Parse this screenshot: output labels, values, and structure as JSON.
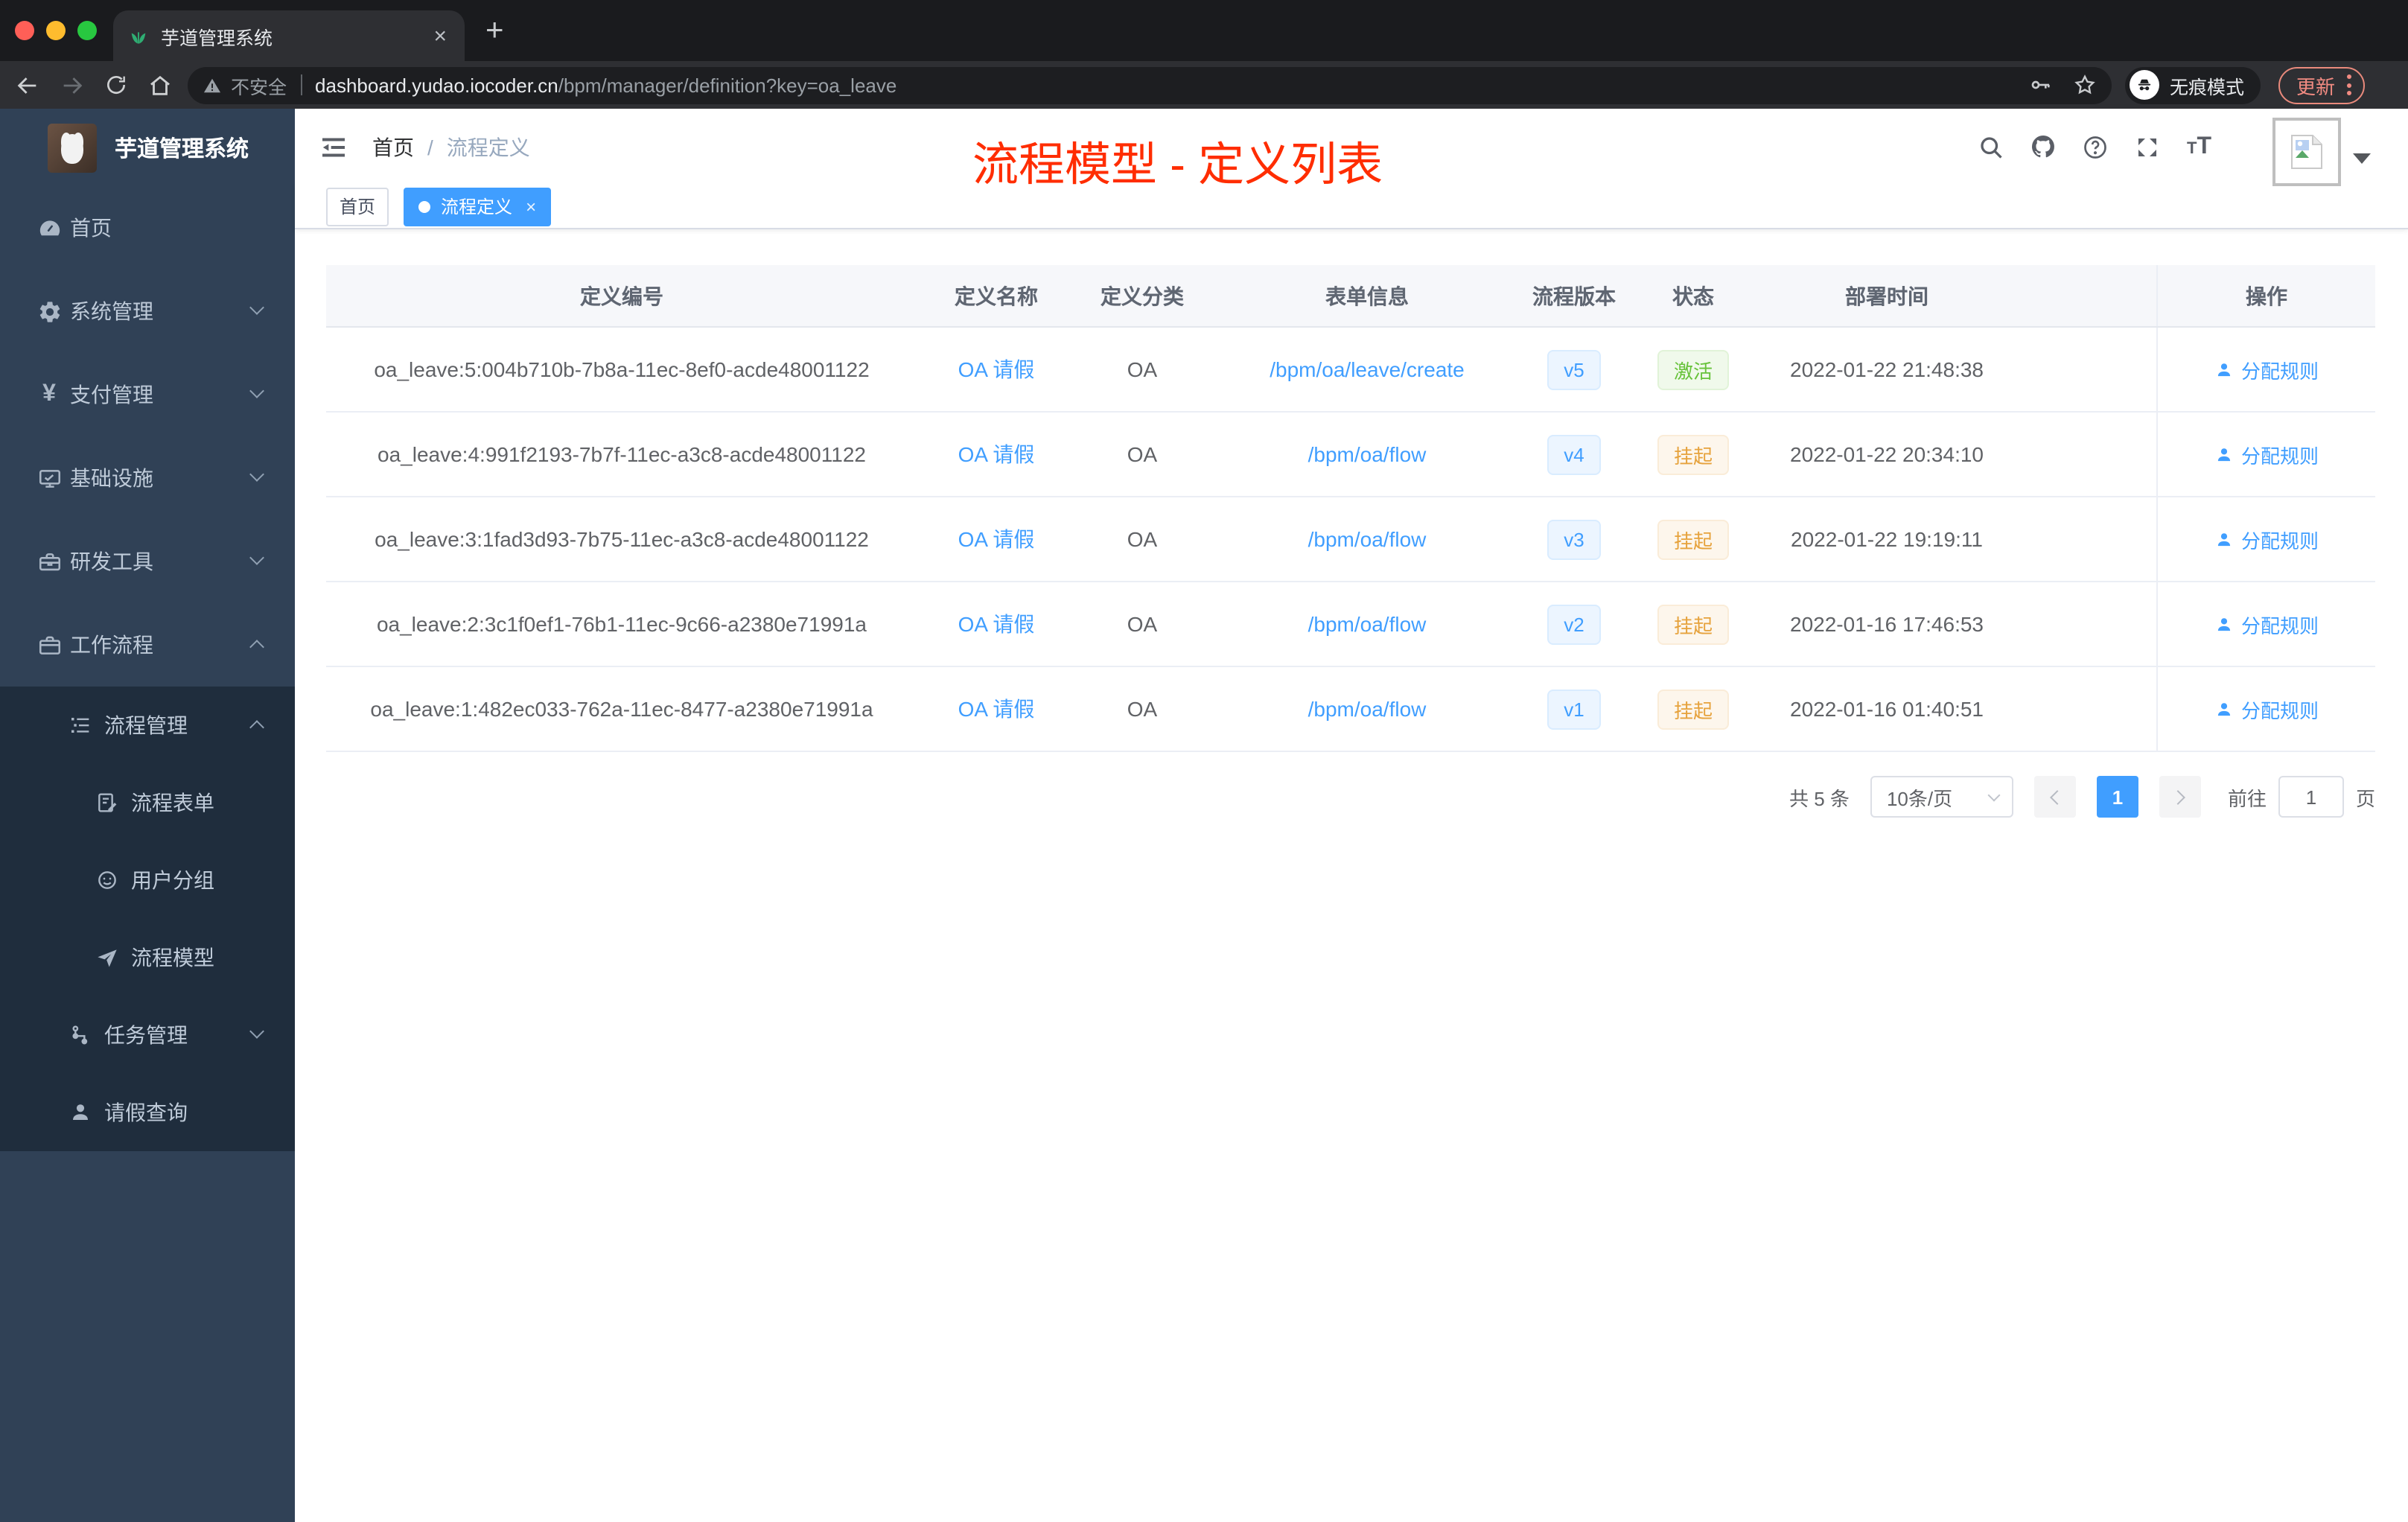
{
  "browser": {
    "tab_title": "芋道管理系统",
    "tab_close": "×",
    "new_tab": "+",
    "security_label": "不安全",
    "url_domain": "dashboard.yudao.iocoder.cn",
    "url_path": "/bpm/manager/definition?key=oa_leave",
    "incognito_label": "无痕模式",
    "update_label": "更新"
  },
  "sidebar": {
    "title": "芋道管理系统",
    "items": [
      {
        "label": "首页",
        "icon": "dashboard-icon"
      },
      {
        "label": "系统管理",
        "icon": "gear-icon"
      },
      {
        "label": "支付管理",
        "icon": "yen-icon"
      },
      {
        "label": "基础设施",
        "icon": "monitor-icon"
      },
      {
        "label": "研发工具",
        "icon": "toolbox-icon"
      },
      {
        "label": "工作流程",
        "icon": "briefcase-icon"
      }
    ],
    "workflow_children": [
      {
        "label": "流程管理",
        "icon": "tree-list-icon"
      },
      {
        "label": "流程表单",
        "icon": "form-icon"
      },
      {
        "label": "用户分组",
        "icon": "people-icon"
      },
      {
        "label": "流程模型",
        "icon": "send-icon"
      },
      {
        "label": "任务管理",
        "icon": "flow-icon"
      },
      {
        "label": "请假查询",
        "icon": "user-icon"
      }
    ]
  },
  "header": {
    "breadcrumb_home": "首页",
    "breadcrumb_sep": "/",
    "breadcrumb_current": "流程定义",
    "annotation_title": "流程模型 - 定义列表"
  },
  "tags": {
    "home": "首页",
    "active": "流程定义",
    "active_close": "×"
  },
  "table": {
    "columns": [
      "定义编号",
      "定义名称",
      "定义分类",
      "表单信息",
      "流程版本",
      "状态",
      "部署时间",
      "操作"
    ],
    "rows": [
      {
        "id": "oa_leave:5:004b710b-7b8a-11ec-8ef0-acde48001122",
        "name": "OA 请假",
        "category": "OA",
        "form": "/bpm/oa/leave/create",
        "version": "v5",
        "status": "激活",
        "status_color": "green",
        "deployed_at": "2022-01-22 21:48:38",
        "action": "分配规则"
      },
      {
        "id": "oa_leave:4:991f2193-7b7f-11ec-a3c8-acde48001122",
        "name": "OA 请假",
        "category": "OA",
        "form": "/bpm/oa/flow",
        "version": "v4",
        "status": "挂起",
        "status_color": "yellow",
        "deployed_at": "2022-01-22 20:34:10",
        "action": "分配规则"
      },
      {
        "id": "oa_leave:3:1fad3d93-7b75-11ec-a3c8-acde48001122",
        "name": "OA 请假",
        "category": "OA",
        "form": "/bpm/oa/flow",
        "version": "v3",
        "status": "挂起",
        "status_color": "yellow",
        "deployed_at": "2022-01-22 19:19:11",
        "action": "分配规则"
      },
      {
        "id": "oa_leave:2:3c1f0ef1-76b1-11ec-9c66-a2380e71991a",
        "name": "OA 请假",
        "category": "OA",
        "form": "/bpm/oa/flow",
        "version": "v2",
        "status": "挂起",
        "status_color": "yellow",
        "deployed_at": "2022-01-16 17:46:53",
        "action": "分配规则"
      },
      {
        "id": "oa_leave:1:482ec033-762a-11ec-8477-a2380e71991a",
        "name": "OA 请假",
        "category": "OA",
        "form": "/bpm/oa/flow",
        "version": "v1",
        "status": "挂起",
        "status_color": "yellow",
        "deployed_at": "2022-01-16 01:40:51",
        "action": "分配规则"
      }
    ]
  },
  "pagination": {
    "total": "共 5 条",
    "page_size": "10条/页",
    "current_page": "1",
    "goto_label": "前往",
    "goto_value": "1",
    "goto_unit": "页"
  },
  "colors": {
    "accent": "#409eff",
    "annotation_red": "#ff2d00",
    "sidebar_bg": "#304156",
    "submenu_bg": "#1f2d3d",
    "status_active_green": "#67c23a",
    "status_suspend_yellow": "#e6a23c"
  }
}
